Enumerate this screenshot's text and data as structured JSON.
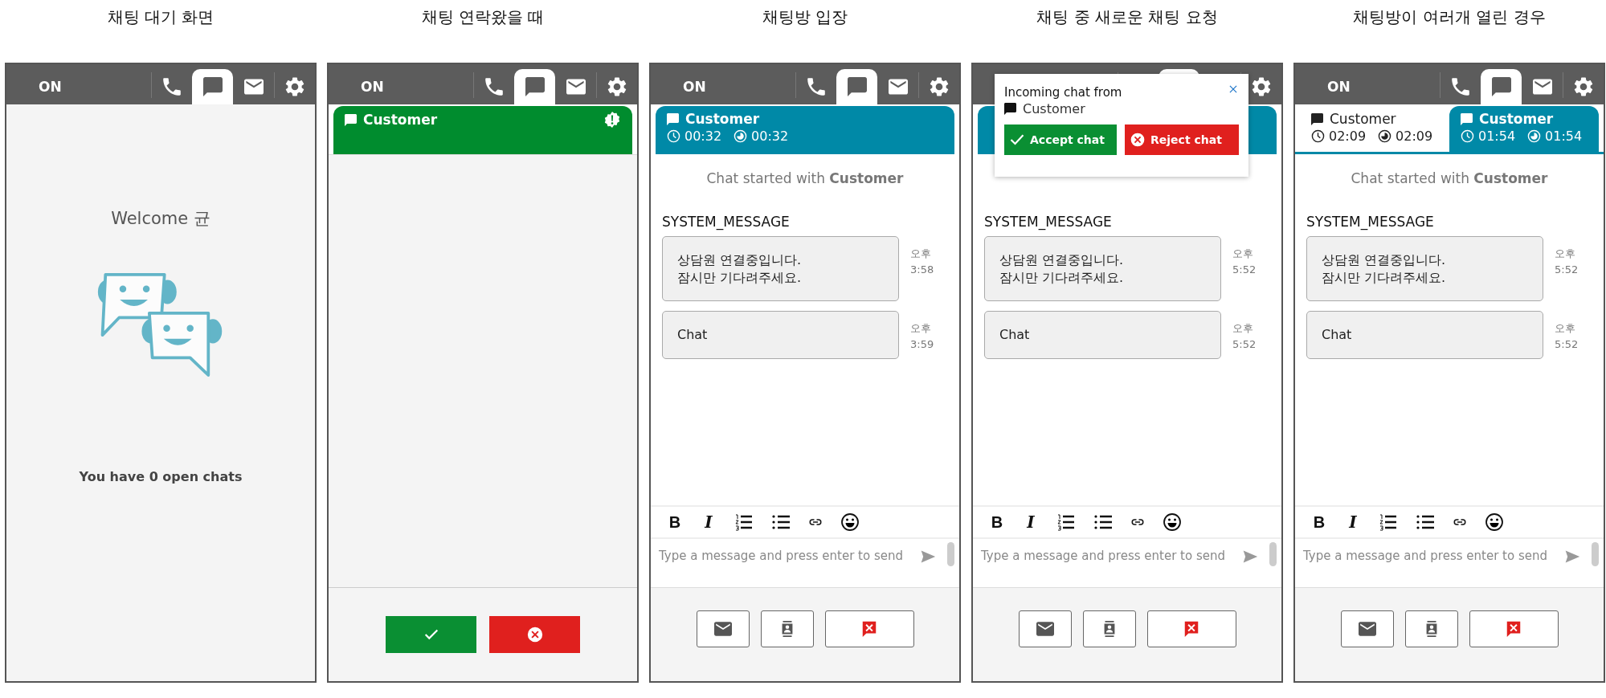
{
  "panels": [
    {
      "caption": "채팅 대기 화면",
      "kind": "welcome",
      "topbar": {
        "status": "ON",
        "tabs": [
          {
            "kind": "phone",
            "selected": false
          },
          {
            "kind": "chat",
            "selected": true
          },
          {
            "kind": "mail",
            "selected": false
          },
          {
            "kind": "settings",
            "selected": false
          }
        ]
      },
      "welcome": "Welcome 균",
      "open_chats": "You have **0** open chats"
    },
    {
      "caption": "채팅 연락왔을 때",
      "kind": "incoming",
      "topbar": {
        "status": "ON",
        "tabs": [
          {
            "kind": "phone",
            "selected": false
          },
          {
            "kind": "chat",
            "selected": true
          },
          {
            "kind": "mail",
            "selected": false
          },
          {
            "kind": "settings",
            "selected": false
          }
        ]
      },
      "chat_tabs": [
        {
          "kind": "incoming",
          "name": "Customer",
          "selected": true
        }
      ],
      "actions": [
        {
          "kind": "accept"
        },
        {
          "kind": "reject"
        }
      ]
    },
    {
      "caption": "채팅방 입장",
      "kind": "chat",
      "topbar": {
        "status": "ON",
        "tabs": [
          {
            "kind": "phone",
            "selected": false
          },
          {
            "kind": "chat",
            "selected": true
          },
          {
            "kind": "mail",
            "selected": false
          },
          {
            "kind": "settings",
            "selected": false
          }
        ]
      },
      "chat_tabs": [
        {
          "kind": "chat",
          "name": "Customer",
          "timer": "00:32",
          "agent_timer": "00:32",
          "selected": true
        }
      ],
      "started": "Chat started with **Customer**",
      "sender": "SYSTEM_MESSAGE",
      "messages": [
        {
          "text": "상담원 연결중입니다.\n잠시만 기다려주세요.",
          "time": "오후 3:58"
        },
        {
          "text": "Chat",
          "time": "오후 3:59"
        }
      ],
      "toolbar": [
        {
          "kind": "bold",
          "label": "B"
        },
        {
          "kind": "italic",
          "label": "I"
        },
        {
          "kind": "ordered-list"
        },
        {
          "kind": "bullet-list"
        },
        {
          "kind": "link"
        },
        {
          "kind": "emoji"
        }
      ],
      "placeholder": "Type a message and press enter to send",
      "actions": [
        {
          "kind": "email"
        },
        {
          "kind": "contact"
        },
        {
          "kind": "end"
        }
      ]
    },
    {
      "caption": "채팅 중 새로운 채팅 요청",
      "kind": "chat",
      "topbar": {
        "tabs": [
          {
            "selected": false
          },
          {
            "selected": true
          },
          {
            "selected": false
          },
          {
            "kind": "settings",
            "selected": false
          }
        ]
      },
      "chat_tabs": [
        {
          "kind": "chat",
          "selected": true,
          "covered": true
        }
      ],
      "popup": {
        "title": "Incoming chat from",
        "name": "Customer",
        "accept": "Accept chat",
        "reject": "Reject chat"
      },
      "sender": "SYSTEM_MESSAGE",
      "messages": [
        {
          "text": "상담원 연결중입니다.\n잠시만 기다려주세요.",
          "time": "오후 5:52"
        },
        {
          "text": "Chat",
          "time": "오후 5:52"
        }
      ],
      "toolbar": [
        {
          "kind": "bold",
          "label": "B"
        },
        {
          "kind": "italic",
          "label": "I"
        },
        {
          "kind": "ordered-list"
        },
        {
          "kind": "bullet-list"
        },
        {
          "kind": "link"
        },
        {
          "kind": "emoji"
        }
      ],
      "placeholder": "Type a message and press enter to send",
      "actions": [
        {
          "kind": "email"
        },
        {
          "kind": "contact"
        },
        {
          "kind": "end"
        }
      ]
    },
    {
      "caption": "채팅방이 여러개 열린 경우",
      "kind": "chat",
      "topbar": {
        "status": "ON",
        "tabs": [
          {
            "kind": "phone",
            "selected": false
          },
          {
            "kind": "chat",
            "selected": true
          },
          {
            "kind": "mail",
            "selected": false
          },
          {
            "kind": "settings",
            "selected": false
          }
        ]
      },
      "chat_tabs": [
        {
          "kind": "chat",
          "name": "Customer",
          "timer": "02:09",
          "agent_timer": "02:09",
          "selected": false
        },
        {
          "kind": "chat",
          "name": "Customer",
          "timer": "01:54",
          "agent_timer": "01:54",
          "selected": true
        }
      ],
      "started": "Chat started with **Customer**",
      "sender": "SYSTEM_MESSAGE",
      "messages": [
        {
          "text": "상담원 연결중입니다.\n잠시만 기다려주세요.",
          "time": "오후 5:52"
        },
        {
          "text": "Chat",
          "time": "오후 5:52"
        }
      ],
      "toolbar": [
        {
          "kind": "bold",
          "label": "B"
        },
        {
          "kind": "italic",
          "label": "I"
        },
        {
          "kind": "ordered-list"
        },
        {
          "kind": "bullet-list"
        },
        {
          "kind": "link"
        },
        {
          "kind": "emoji"
        }
      ],
      "placeholder": "Type a message and press enter to send",
      "actions": [
        {
          "kind": "email"
        },
        {
          "kind": "contact"
        },
        {
          "kind": "end"
        }
      ]
    }
  ]
}
